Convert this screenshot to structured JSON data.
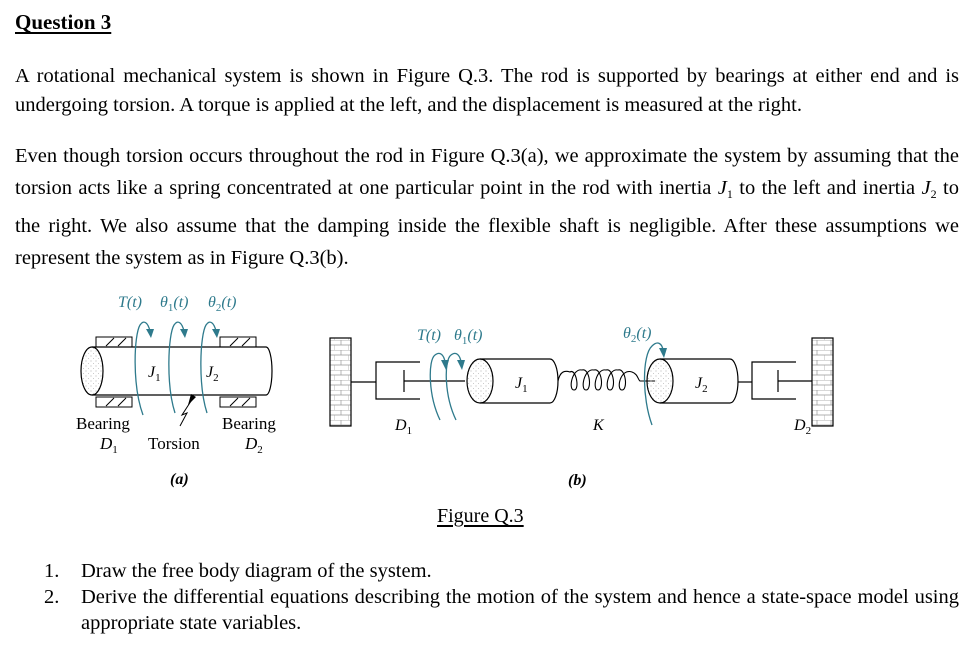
{
  "heading": "Question 3",
  "paragraph1": "A rotational mechanical system is shown in Figure Q.3. The rod is supported by bearings at either end and is undergoing torsion. A torque is applied at the left, and the displacement is measured at the right.",
  "paragraph2": {
    "part1": "Even though torsion occurs throughout the rod in Figure Q.3(a), we approximate the system by assuming that the torsion acts like a spring concentrated at one particular point in the rod with inertia ",
    "j1_symbol": "J",
    "j1_sub": "1",
    "part2": " to the left and inertia ",
    "j2_symbol": "J",
    "j2_sub": "2",
    "part3": " to the right. We also assume that the damping inside the flexible shaft is negligible. After these assumptions we represent the system as in Figure Q.3(b)."
  },
  "figure_a": {
    "labels": {
      "torque": "T(t)",
      "theta1": "θ",
      "theta1_sub": "1",
      "theta1_arg": "(t)",
      "theta2": "θ",
      "theta2_sub": "2",
      "theta2_arg": "(t)",
      "j1": "J",
      "j1_sub": "1",
      "j2": "J",
      "j2_sub": "2",
      "bearing_left": "Bearing",
      "bearing_right": "Bearing",
      "d1": "D",
      "d1_sub": "1",
      "d2": "D",
      "d2_sub": "2",
      "torsion": "Torsion",
      "caption": "(a)"
    }
  },
  "figure_b": {
    "labels": {
      "torque": "T(t)",
      "theta1": "θ",
      "theta1_sub": "1",
      "theta1_arg": "(t)",
      "theta2": "θ",
      "theta2_sub": "2",
      "theta2_arg": "(t)",
      "j1": "J",
      "j1_sub": "1",
      "j2": "J",
      "j2_sub": "2",
      "d1": "D",
      "d1_sub": "1",
      "d2": "D",
      "d2_sub": "2",
      "spring": "K",
      "caption": "(b)"
    }
  },
  "figure_caption": "Figure Q.3",
  "colors": {
    "accent": "#2e7a8c",
    "ink": "#000000"
  },
  "tasks": [
    {
      "number": "1.",
      "text": "Draw the free body diagram of the system."
    },
    {
      "number": "2.",
      "text": "Derive the differential equations describing the motion of the system and hence a state-space model using appropriate state variables."
    }
  ]
}
